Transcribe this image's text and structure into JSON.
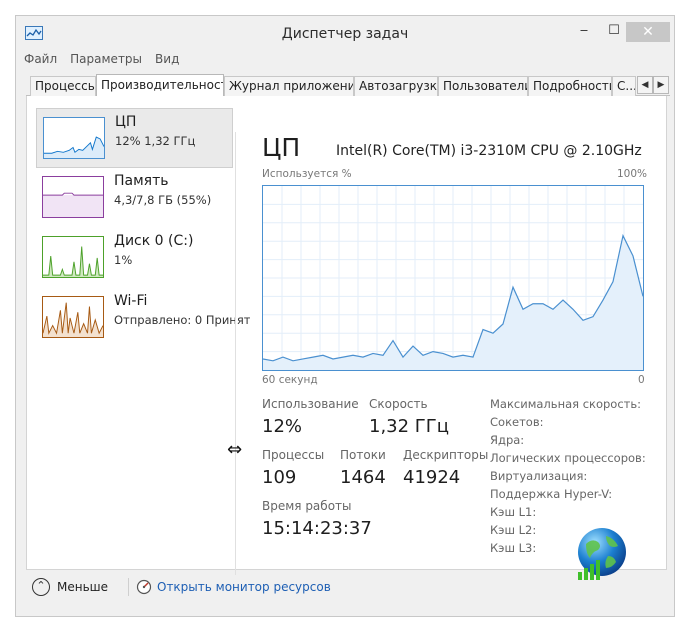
{
  "window": {
    "title": "Диспетчер задач",
    "minimize": "‒",
    "maximize": "☐",
    "close": "✕"
  },
  "menu": [
    "Файл",
    "Параметры",
    "Вид"
  ],
  "tabs": [
    {
      "label": "Процессы"
    },
    {
      "label": "Производительность"
    },
    {
      "label": "Журнал приложений"
    },
    {
      "label": "Автозагрузка"
    },
    {
      "label": "Пользователи"
    },
    {
      "label": "Подробности"
    },
    {
      "label": "С..."
    }
  ],
  "active_tab": 1,
  "tab_scroll": {
    "left": "◀",
    "right": "▶"
  },
  "sidebar": [
    {
      "name": "ЦП",
      "sub": "12% 1,32 ГГц",
      "color": "#1177cc",
      "icon": "cpu-graph"
    },
    {
      "name": "Память",
      "sub": "4,3/7,8 ГБ (55%)",
      "color": "#8b3e9e",
      "icon": "memory-graph"
    },
    {
      "name": "Диск 0 (C:)",
      "sub": "1%",
      "color": "#4da12a",
      "icon": "disk-graph"
    },
    {
      "name": "Wi-Fi",
      "sub": "Отправлено: 0 Принят",
      "color": "#a75a14",
      "icon": "wifi-graph"
    }
  ],
  "cpu": {
    "title": "ЦП",
    "model": "Intel(R) Core(TM) i3-2310M CPU @ 2.10GHz",
    "graph_label_left": "Используется %",
    "graph_label_right": "100%",
    "axis_left": "60 секунд",
    "axis_right": "0",
    "usage_history": [
      6,
      5,
      7,
      5,
      6,
      7,
      8,
      6,
      7,
      8,
      7,
      9,
      8,
      16,
      7,
      13,
      8,
      10,
      9,
      7,
      8,
      7,
      22,
      20,
      25,
      45,
      33,
      36,
      36,
      33,
      38,
      33,
      27,
      29,
      38,
      48,
      73,
      62,
      40
    ]
  },
  "stats": {
    "usage_label": "Использование",
    "usage_value": "12%",
    "speed_label": "Скорость",
    "speed_value": "1,32 ГГц",
    "processes_label": "Процессы",
    "processes_value": "109",
    "threads_label": "Потоки",
    "threads_value": "1464",
    "handles_label": "Дескрипторы",
    "handles_value": "41924",
    "uptime_label": "Время работы",
    "uptime_value": "15:14:23:37"
  },
  "details": [
    "Максимальная скорость:",
    "Сокетов:",
    "Ядра:",
    "Логических процессоров:",
    "Виртуализация:",
    "Поддержка Hyper-V:",
    "Кэш L1:",
    "Кэш L2:",
    "Кэш L3:"
  ],
  "footer": {
    "less_label": "Меньше",
    "monitor_link": "Открыть монитор ресурсов",
    "less_icon": "⌃"
  },
  "colors": {
    "accent": "#4a90d0",
    "link": "#1e5fb4"
  }
}
